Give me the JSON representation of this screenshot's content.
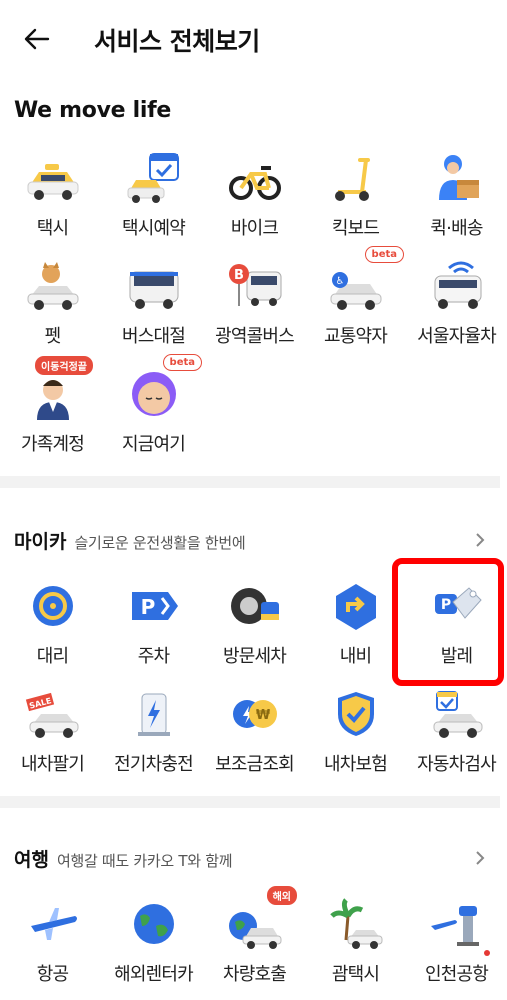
{
  "header": {
    "title": "서비스 전체보기",
    "back_icon": "arrow-left-icon"
  },
  "sections": {
    "move": {
      "title": "We move life",
      "items": [
        {
          "label": "택시",
          "icon": "taxi-icon"
        },
        {
          "label": "택시예약",
          "icon": "taxi-reservation-icon"
        },
        {
          "label": "바이크",
          "icon": "bike-icon"
        },
        {
          "label": "킥보드",
          "icon": "kickboard-icon"
        },
        {
          "label": "퀵·배송",
          "icon": "quick-delivery-icon"
        },
        {
          "label": "펫",
          "icon": "pet-icon"
        },
        {
          "label": "버스대절",
          "icon": "bus-charter-icon"
        },
        {
          "label": "광역콜버스",
          "icon": "metro-bus-icon"
        },
        {
          "label": "교통약자",
          "icon": "accessibility-car-icon",
          "badge": "beta"
        },
        {
          "label": "서울자율차",
          "icon": "seoul-autonomous-car-icon"
        },
        {
          "label": "가족계정",
          "icon": "family-account-icon",
          "badge": "이동걱정끝"
        },
        {
          "label": "지금여기",
          "icon": "here-now-icon",
          "badge": "beta"
        }
      ]
    },
    "mycar": {
      "name": "마이카",
      "subtitle": "슬기로운 운전생활을 한번에",
      "items": [
        {
          "label": "대리",
          "icon": "designated-driver-icon"
        },
        {
          "label": "주차",
          "icon": "parking-icon"
        },
        {
          "label": "방문세차",
          "icon": "car-wash-icon"
        },
        {
          "label": "내비",
          "icon": "navigation-icon"
        },
        {
          "label": "발레",
          "icon": "valet-icon"
        },
        {
          "label": "내차팔기",
          "icon": "sell-car-icon"
        },
        {
          "label": "전기차충전",
          "icon": "ev-charging-icon"
        },
        {
          "label": "보조금조회",
          "icon": "subsidy-icon"
        },
        {
          "label": "내차보험",
          "icon": "car-insurance-icon"
        },
        {
          "label": "자동차검사",
          "icon": "car-inspection-icon"
        }
      ]
    },
    "travel": {
      "name": "여행",
      "subtitle": "여행갈 때도 카카오 T와 함께",
      "items": [
        {
          "label": "항공",
          "icon": "airplane-icon"
        },
        {
          "label": "해외렌터카",
          "icon": "overseas-rental-icon"
        },
        {
          "label": "차량호출",
          "icon": "car-call-icon",
          "badge": "해외"
        },
        {
          "label": "괌택시",
          "icon": "guam-taxi-icon"
        },
        {
          "label": "인천공항",
          "icon": "incheon-airport-icon"
        }
      ]
    }
  },
  "colors": {
    "accent_red": "#ff0000",
    "taxi_yellow": "#f7c948",
    "blue": "#2f6fe0"
  }
}
